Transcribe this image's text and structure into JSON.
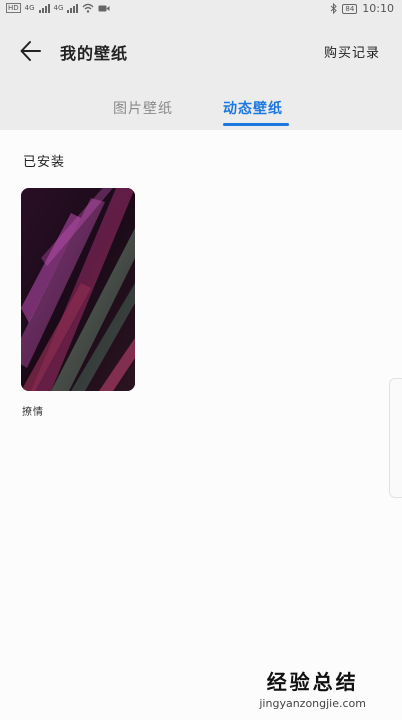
{
  "status_bar": {
    "hd_badge": "HD",
    "net1": "4G",
    "net2": "4G",
    "battery": "84",
    "time": "10:10"
  },
  "header": {
    "title": "我的壁纸",
    "purchase_history": "购买记录"
  },
  "tabs": [
    {
      "label": "图片壁纸",
      "active": false
    },
    {
      "label": "动态壁纸",
      "active": true
    }
  ],
  "colors": {
    "accent": "#1d78e0",
    "header_bg": "#ececec",
    "content_bg": "#fcfcfc"
  },
  "installed": {
    "heading": "已安装",
    "items": [
      {
        "name": "撩情"
      }
    ]
  },
  "watermark": {
    "title": "经验总结",
    "url": "jingyanzongjie.com"
  }
}
